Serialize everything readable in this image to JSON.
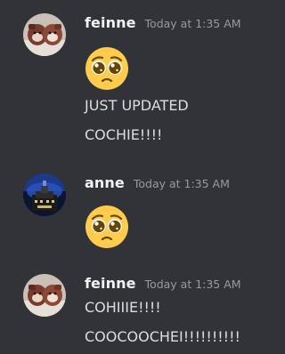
{
  "messages": [
    {
      "username": "feinne",
      "timestamp": "Today at 1:35 AM",
      "avatar_icon": "plush-photo-avatar",
      "emoji": "pleading-face",
      "lines": [
        "JUST UPDATED",
        "COCHIE!!!!"
      ]
    },
    {
      "username": "anne",
      "timestamp": "Today at 1:35 AM",
      "avatar_icon": "dark-night-scene-avatar",
      "emoji": "pleading-face",
      "lines": []
    },
    {
      "username": "feinne",
      "timestamp": "Today at 1:35 AM",
      "avatar_icon": "plush-photo-avatar",
      "lines": [
        "COHIIIE!!!!",
        "COOCOOCHEI!!!!!!!!!!"
      ]
    }
  ],
  "colors": {
    "background": "#313338",
    "username": "#f2f3f5",
    "timestamp": "#949ba4",
    "text": "#dbdee1",
    "emoji_face": "#ffcc4d"
  }
}
